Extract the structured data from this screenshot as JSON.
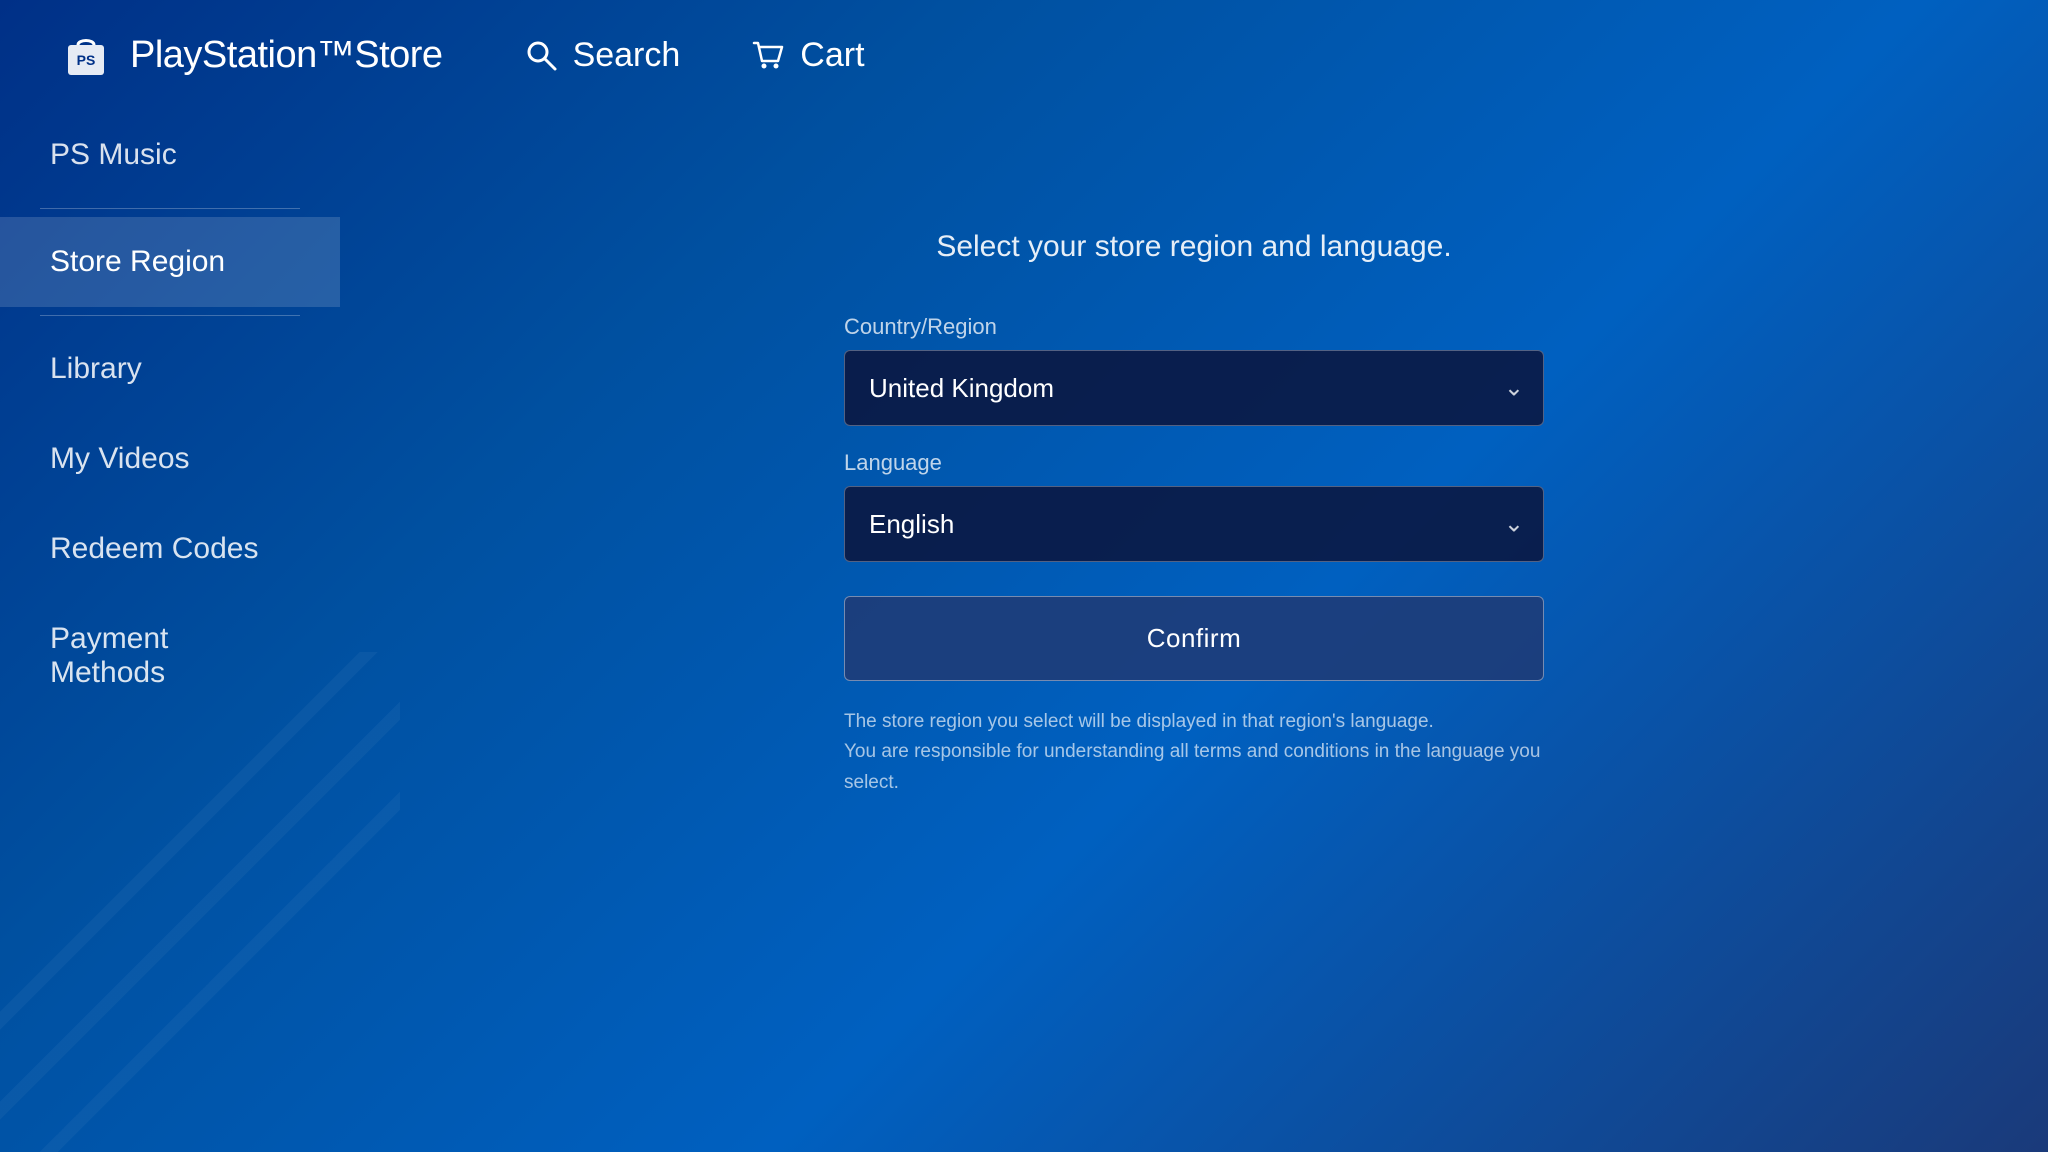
{
  "header": {
    "logo_text": "PlayStation™Store",
    "nav": [
      {
        "id": "search",
        "label": "Search",
        "icon": "search-icon"
      },
      {
        "id": "cart",
        "label": "Cart",
        "icon": "cart-icon"
      }
    ]
  },
  "sidebar": {
    "items": [
      {
        "id": "ps-music",
        "label": "PS Music",
        "active": false
      },
      {
        "id": "store-region",
        "label": "Store Region",
        "active": true
      },
      {
        "id": "library",
        "label": "Library",
        "active": false
      },
      {
        "id": "my-videos",
        "label": "My Videos",
        "active": false
      },
      {
        "id": "redeem-codes",
        "label": "Redeem Codes",
        "active": false
      },
      {
        "id": "payment-methods",
        "label": "Payment Methods",
        "active": false
      }
    ]
  },
  "main": {
    "title": "Select your store region and language.",
    "country_label": "Country/Region",
    "country_value": "United Kingdom",
    "language_label": "Language",
    "language_value": "English",
    "confirm_label": "Confirm",
    "disclaimer": "The store region you select will be displayed in that region's language.\nYou are responsible for understanding all terms and conditions in the language you select."
  }
}
